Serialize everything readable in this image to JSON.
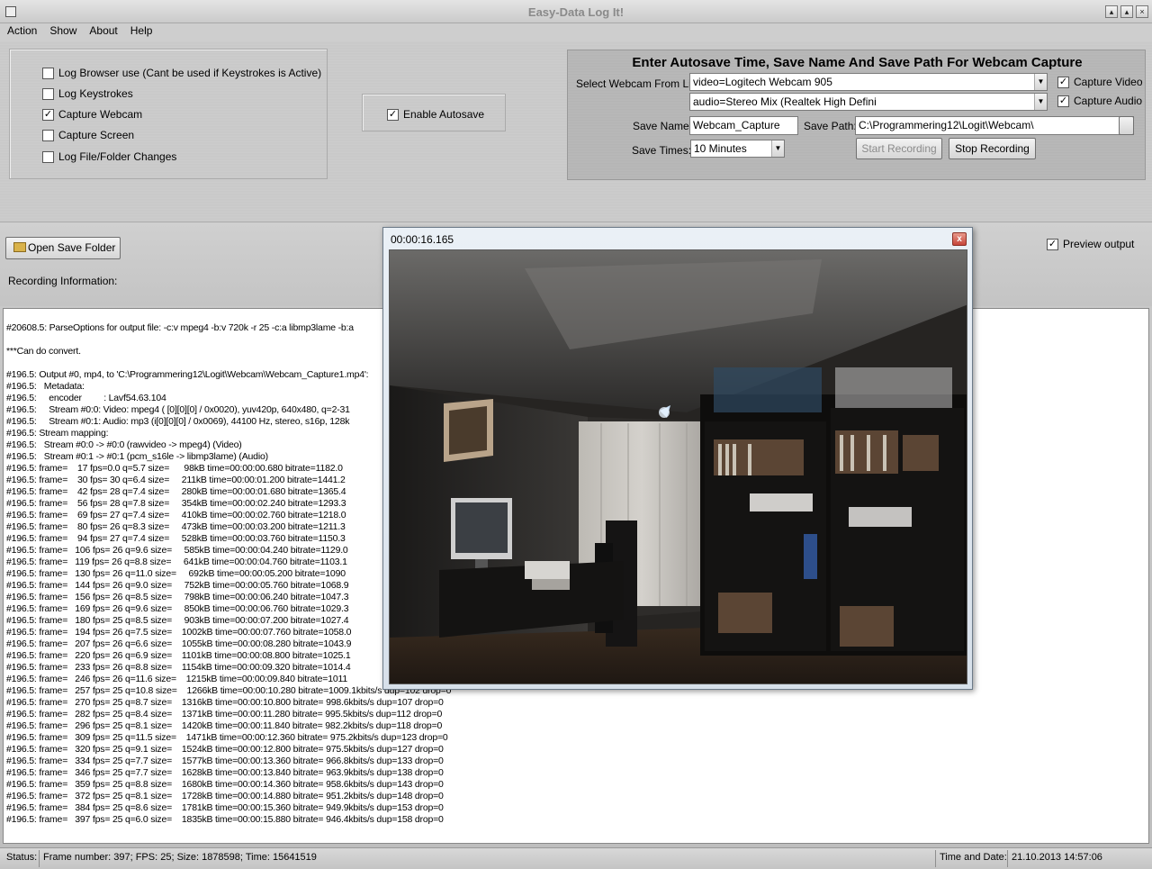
{
  "window": {
    "title": "Easy-Data Log It!"
  },
  "menu": [
    "Action",
    "Show",
    "About",
    "Help"
  ],
  "options": {
    "items": [
      {
        "label": "Log Browser use (Cant be used if Keystrokes is Active)",
        "checked": false
      },
      {
        "label": "Log Keystrokes",
        "checked": false
      },
      {
        "label": "Capture Webcam",
        "checked": true
      },
      {
        "label": "Capture Screen",
        "checked": false
      },
      {
        "label": "Log File/Folder Changes",
        "checked": false
      }
    ],
    "autosave_label": "Enable Autosave",
    "autosave_checked": true
  },
  "webcam": {
    "heading": "Enter Autosave Time, Save Name And Save Path For Webcam Capture",
    "select_label": "Select Webcam From List",
    "video_device": "video=Logitech Webcam 905",
    "audio_device": "audio=Stereo Mix (Realtek High Defini",
    "capture_video_label": "Capture Video",
    "capture_audio_label": "Capture Audio",
    "save_name_label": "Save Name:",
    "save_name": "Webcam_Capture",
    "save_path_label": "Save Path:",
    "save_path": "C:\\Programmering12\\Logit\\Webcam\\",
    "save_times_label": "Save Times:",
    "save_times": "10 Minutes",
    "start_label": "Start Recording",
    "stop_label": "Stop Recording"
  },
  "mid": {
    "open_folder_label": "Open Save Folder",
    "recording_info_label": "Recording Information:",
    "preview_output_label": "Preview output"
  },
  "preview_window": {
    "title": "00:00:16.165",
    "close_glyph": "x"
  },
  "log_lines": [
    "#20608.5: ParseOptions for output file: -c:v mpeg4 -b:v 720k -r 25 -c:a libmp3lame -b:a",
    "",
    "***Can do convert.",
    "",
    "#196.5: Output #0, mp4, to 'C:\\Programmering12\\Logit\\Webcam\\Webcam_Capture1.mp4':",
    "#196.5:   Metadata:",
    "#196.5:     encoder         : Lavf54.63.104",
    "#196.5:     Stream #0:0: Video: mpeg4 ( [0][0][0] / 0x0020), yuv420p, 640x480, q=2-31",
    "#196.5:     Stream #0:1: Audio: mp3 (i[0][0][0] / 0x0069), 44100 Hz, stereo, s16p, 128k",
    "#196.5: Stream mapping:",
    "#196.5:   Stream #0:0 -> #0:0 (rawvideo -> mpeg4) (Video)",
    "#196.5:   Stream #0:1 -> #0:1 (pcm_s16le -> libmp3lame) (Audio)",
    "#196.5: frame=    17 fps=0.0 q=5.7 size=      98kB time=00:00:00.680 bitrate=1182.0",
    "#196.5: frame=    30 fps= 30 q=6.4 size=     211kB time=00:00:01.200 bitrate=1441.2",
    "#196.5: frame=    42 fps= 28 q=7.4 size=     280kB time=00:00:01.680 bitrate=1365.4",
    "#196.5: frame=    56 fps= 28 q=7.8 size=     354kB time=00:00:02.240 bitrate=1293.3",
    "#196.5: frame=    69 fps= 27 q=7.4 size=     410kB time=00:00:02.760 bitrate=1218.0",
    "#196.5: frame=    80 fps= 26 q=8.3 size=     473kB time=00:00:03.200 bitrate=1211.3",
    "#196.5: frame=    94 fps= 27 q=7.4 size=     528kB time=00:00:03.760 bitrate=1150.3",
    "#196.5: frame=   106 fps= 26 q=9.6 size=     585kB time=00:00:04.240 bitrate=1129.0",
    "#196.5: frame=   119 fps= 26 q=8.8 size=     641kB time=00:00:04.760 bitrate=1103.1",
    "#196.5: frame=   130 fps= 26 q=11.0 size=     692kB time=00:00:05.200 bitrate=1090",
    "#196.5: frame=   144 fps= 26 q=9.0 size=     752kB time=00:00:05.760 bitrate=1068.9",
    "#196.5: frame=   156 fps= 26 q=8.5 size=     798kB time=00:00:06.240 bitrate=1047.3",
    "#196.5: frame=   169 fps= 26 q=9.6 size=     850kB time=00:00:06.760 bitrate=1029.3",
    "#196.5: frame=   180 fps= 25 q=8.5 size=     903kB time=00:00:07.200 bitrate=1027.4",
    "#196.5: frame=   194 fps= 26 q=7.5 size=    1002kB time=00:00:07.760 bitrate=1058.0",
    "#196.5: frame=   207 fps= 26 q=6.6 size=    1055kB time=00:00:08.280 bitrate=1043.9",
    "#196.5: frame=   220 fps= 26 q=6.9 size=    1101kB time=00:00:08.800 bitrate=1025.1",
    "#196.5: frame=   233 fps= 26 q=8.8 size=    1154kB time=00:00:09.320 bitrate=1014.4",
    "#196.5: frame=   246 fps= 26 q=11.6 size=    1215kB time=00:00:09.840 bitrate=1011",
    "#196.5: frame=   257 fps= 25 q=10.8 size=    1266kB time=00:00:10.280 bitrate=1009.1kbits/s dup=102 drop=0",
    "#196.5: frame=   270 fps= 25 q=8.7 size=    1316kB time=00:00:10.800 bitrate= 998.6kbits/s dup=107 drop=0",
    "#196.5: frame=   282 fps= 25 q=8.4 size=    1371kB time=00:00:11.280 bitrate= 995.5kbits/s dup=112 drop=0",
    "#196.5: frame=   296 fps= 25 q=8.1 size=    1420kB time=00:00:11.840 bitrate= 982.2kbits/s dup=118 drop=0",
    "#196.5: frame=   309 fps= 25 q=11.5 size=    1471kB time=00:00:12.360 bitrate= 975.2kbits/s dup=123 drop=0",
    "#196.5: frame=   320 fps= 25 q=9.1 size=    1524kB time=00:00:12.800 bitrate= 975.5kbits/s dup=127 drop=0",
    "#196.5: frame=   334 fps= 25 q=7.7 size=    1577kB time=00:00:13.360 bitrate= 966.8kbits/s dup=133 drop=0",
    "#196.5: frame=   346 fps= 25 q=7.7 size=    1628kB time=00:00:13.840 bitrate= 963.9kbits/s dup=138 drop=0",
    "#196.5: frame=   359 fps= 25 q=8.8 size=    1680kB time=00:00:14.360 bitrate= 958.6kbits/s dup=143 drop=0",
    "#196.5: frame=   372 fps= 25 q=8.1 size=    1728kB time=00:00:14.880 bitrate= 951.2kbits/s dup=148 drop=0",
    "#196.5: frame=   384 fps= 25 q=8.6 size=    1781kB time=00:00:15.360 bitrate= 949.9kbits/s dup=153 drop=0",
    "#196.5: frame=   397 fps= 25 q=6.0 size=    1835kB time=00:00:15.880 bitrate= 946.4kbits/s dup=158 drop=0"
  ],
  "status": {
    "label": "Status:",
    "text": "Frame number: 397; FPS: 25; Size: 1878598; Time: 15641519",
    "datetime_label": "Time and Date:",
    "datetime": "21.10.2013 14:57:06"
  }
}
